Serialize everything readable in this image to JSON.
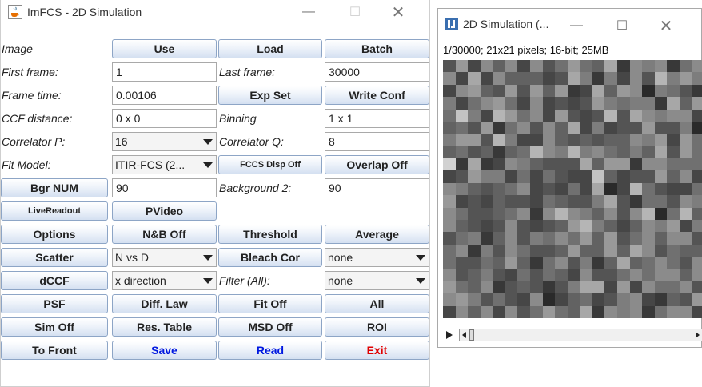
{
  "win1": {
    "title": "ImFCS - 2D Simulation",
    "rows": [
      [
        {
          "t": "label",
          "v": "Image"
        },
        {
          "t": "button",
          "v": "Use"
        },
        {
          "t": "button",
          "v": "Load"
        },
        {
          "t": "button",
          "v": "Batch"
        }
      ],
      [
        {
          "t": "label",
          "v": "First frame:"
        },
        {
          "t": "field",
          "v": "1"
        },
        {
          "t": "label",
          "v": "Last frame:"
        },
        {
          "t": "field",
          "v": "30000"
        }
      ],
      [
        {
          "t": "label",
          "v": "Frame time:"
        },
        {
          "t": "field",
          "v": "0.00106"
        },
        {
          "t": "button",
          "v": "Exp Set"
        },
        {
          "t": "button",
          "v": "Write Conf"
        }
      ],
      [
        {
          "t": "label",
          "v": "CCF distance:"
        },
        {
          "t": "field",
          "v": "0 x 0"
        },
        {
          "t": "label",
          "v": "Binning"
        },
        {
          "t": "field",
          "v": "1 x 1"
        }
      ],
      [
        {
          "t": "label",
          "v": "Correlator P:"
        },
        {
          "t": "combo",
          "v": "16"
        },
        {
          "t": "label",
          "v": "Correlator Q:"
        },
        {
          "t": "field",
          "v": "8"
        }
      ],
      [
        {
          "t": "label",
          "v": "Fit Model:"
        },
        {
          "t": "combo",
          "v": "ITIR-FCS (2..."
        },
        {
          "t": "button",
          "v": "FCCS Disp Off",
          "small": true
        },
        {
          "t": "button",
          "v": "Overlap Off"
        }
      ],
      [
        {
          "t": "button",
          "v": "Bgr NUM"
        },
        {
          "t": "field",
          "v": "90"
        },
        {
          "t": "label",
          "v": "Background 2:"
        },
        {
          "t": "field",
          "v": "90"
        }
      ],
      [
        {
          "t": "button",
          "v": "LiveReadout",
          "small": true
        },
        {
          "t": "button",
          "v": "PVideo"
        },
        {
          "t": "empty"
        },
        {
          "t": "empty"
        }
      ],
      [
        {
          "t": "button",
          "v": "Options"
        },
        {
          "t": "button",
          "v": "N&B Off"
        },
        {
          "t": "button",
          "v": "Threshold"
        },
        {
          "t": "button",
          "v": "Average"
        }
      ],
      [
        {
          "t": "button",
          "v": "Scatter"
        },
        {
          "t": "combo",
          "v": "N vs D"
        },
        {
          "t": "button",
          "v": "Bleach Cor"
        },
        {
          "t": "combo",
          "v": "none"
        }
      ],
      [
        {
          "t": "button",
          "v": "dCCF"
        },
        {
          "t": "combo",
          "v": "x direction"
        },
        {
          "t": "label",
          "v": "Filter (All):"
        },
        {
          "t": "combo",
          "v": "none"
        }
      ],
      [
        {
          "t": "button",
          "v": "PSF"
        },
        {
          "t": "button",
          "v": "Diff. Law"
        },
        {
          "t": "button",
          "v": "Fit Off"
        },
        {
          "t": "button",
          "v": "All"
        }
      ],
      [
        {
          "t": "button",
          "v": "Sim Off"
        },
        {
          "t": "button",
          "v": "Res. Table"
        },
        {
          "t": "button",
          "v": "MSD Off"
        },
        {
          "t": "button",
          "v": "ROI"
        }
      ],
      [
        {
          "t": "button",
          "v": "To Front"
        },
        {
          "t": "button",
          "v": "Save",
          "color": "#0018e0"
        },
        {
          "t": "button",
          "v": "Read",
          "color": "#0018e0"
        },
        {
          "t": "button",
          "v": "Exit",
          "color": "#e00000"
        }
      ]
    ]
  },
  "win2": {
    "title": "2D Simulation (...",
    "info": "1/30000; 21x21 pixels; 16-bit; 25MB",
    "image_grid_size": 21,
    "pixels": "6B5A7A5A68B87C4A9A48AA5C5A77756C9495A6D9B95AB76B6B7B45C7BA39864958AB85A5656B98994C7B8E95DB8A5B656D6CA9AA5786B48A6A7C59566B66939BB6D955A767677A9B5B87867478DA9D9A8797C6B8F4C45A97666C7BB4AA88856B995858655E7566B7A5A97678A56585C35D86558B565766587669C64886A9A86678A4ADA97A6AD38D7A7656A6567BD9757A9B5968947A698A8B7B68A7AA68A496A8667B77B7CA687786687B748A6947C78A86AA6796586875A668A8AA7AB87A4676469CC5B5A88A6AB96865A3578569A547"
  }
}
